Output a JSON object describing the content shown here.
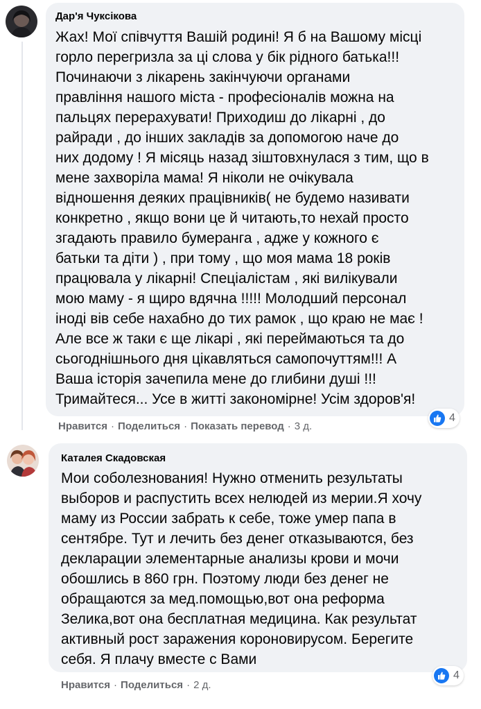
{
  "comments": [
    {
      "author": "Дар'я Чуксікова",
      "text": "Жах! Мої співчуття Вашій родині! Я б на Вашому місці\nгорло перегризла за ці слова у бік рідного батька!!!\nПочинаючи з лікарень закінчуючи органами\nправління нашого міста - професіоналів можна на\nпальцях перерахувати! Приходиш до лікарні , до\nрайради , до інших закладів за допомогою наче до\nних додому ! Я місяць назад зіштовхнулася з тим, що в\nмене захворіла мама! Я ніколи не очікувала\nвідношення деяких працівників( не будемо називати\nконкретно , якщо вони це й читають,то нехай просто\nзгадають правило бумеранга , адже у кожного є\nбатьки та діти ) , при тому , що моя мама 18 років\nпрацювала у лікарні! Спеціалістам , які вилікували\nмою маму - я щиро вдячна !!!!! Молодший персонал\nіноді вів себе нахабно до тих рамок , що краю не має !\nАле все ж таки є ще лікарі , які переймаються та до\nсьогоднішнього дня цікавляться самопочуттям!!! А\nВаша історія зачепила мене до глибини душі !!!\nТримайтеся... Усе в житті закономірне! Усім здоров'я!",
      "like": "Нравится",
      "share": "Поделиться",
      "translate": "Показать перевод",
      "time": "3 д.",
      "reactions": "4"
    },
    {
      "author": "Каталея Скадовская",
      "text": "Мои соболезнования! Нужно отменить результаты\nвыборов и распустить всех нелюдей из мерии.Я хочу\nмаму из России забрать к себе, тоже умер папа в\nсентябре. Тут и лечить без денег отказываются, без\nдекларации элементарные анализы крови и мочи\nобошлись в 860 грн. Поэтому люди без денег не\nобращаются за мед.помощью,вот она реформа\nЗелика,вот она бесплатная медицина. Как результат\nактивный рост заражения короновирусом. Берегите\nсебя. Я плачу вместе с Вами",
      "like": "Нравится",
      "share": "Поделиться",
      "time": "2 д.",
      "reactions": "4"
    }
  ],
  "colors": {
    "bubble": "#f0f2f5",
    "meta": "#65676b",
    "like_blue": "#1877f2"
  }
}
